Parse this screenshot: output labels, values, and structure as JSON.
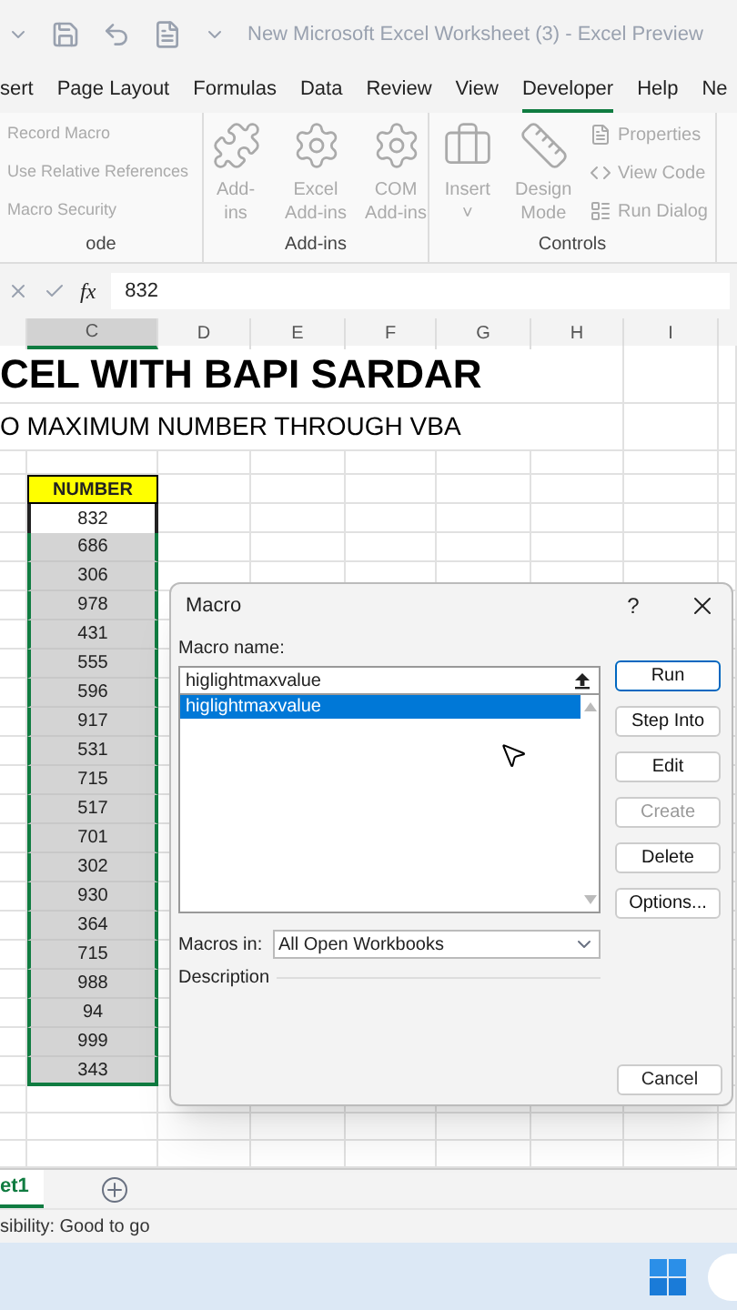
{
  "title_bar": {
    "title": "New Microsoft Excel Worksheet (3)  -  Excel Preview"
  },
  "ribbon_tabs": [
    {
      "label": "sert",
      "selected": false
    },
    {
      "label": "Page Layout",
      "selected": false
    },
    {
      "label": "Formulas",
      "selected": false
    },
    {
      "label": "Data",
      "selected": false
    },
    {
      "label": "Review",
      "selected": false
    },
    {
      "label": "View",
      "selected": false
    },
    {
      "label": "Developer",
      "selected": true
    },
    {
      "label": "Help",
      "selected": false
    },
    {
      "label": "Ne",
      "selected": false
    }
  ],
  "ribbon_groups": [
    {
      "label": "ode",
      "items": [
        {
          "kind": "small",
          "label": "Record Macro"
        },
        {
          "kind": "small",
          "label": "Use Relative References"
        },
        {
          "kind": "small",
          "label": "Macro Security"
        }
      ]
    },
    {
      "label": "Add-ins",
      "items": [
        {
          "kind": "large",
          "label": "Add-\nins"
        },
        {
          "kind": "large",
          "label": "Excel\nAdd-ins"
        },
        {
          "kind": "large",
          "label": "COM\nAdd-ins"
        }
      ]
    },
    {
      "label": "Controls",
      "items": [
        {
          "kind": "large",
          "label": "Insert\n˅"
        },
        {
          "kind": "large",
          "label": "Design\nMode"
        },
        {
          "kind": "small",
          "label": "Properties"
        },
        {
          "kind": "small",
          "label": "View Code"
        },
        {
          "kind": "small",
          "label": "Run Dialog"
        }
      ]
    }
  ],
  "formula_bar": {
    "fx_label": "fx",
    "value": "832"
  },
  "columns": [
    {
      "label": "C",
      "selected": true
    },
    {
      "label": "D",
      "selected": false
    },
    {
      "label": "E",
      "selected": false
    },
    {
      "label": "F",
      "selected": false
    },
    {
      "label": "G",
      "selected": false
    },
    {
      "label": "H",
      "selected": false
    },
    {
      "label": "I",
      "selected": false
    }
  ],
  "sheet": {
    "title": "CEL WITH BAPI SARDAR",
    "subtitle": "O MAXIMUM NUMBER THROUGH VBA",
    "header": "NUMBER",
    "range_selected": true,
    "values": [
      "832",
      "686",
      "306",
      "978",
      "431",
      "555",
      "596",
      "917",
      "531",
      "715",
      "517",
      "701",
      "302",
      "930",
      "364",
      "715",
      "988",
      "94",
      "999",
      "343"
    ]
  },
  "dialog": {
    "title": "Macro",
    "help": "?",
    "macro_name_label": "Macro name:",
    "macro_name_value": "higlightmaxvalue",
    "macros": [
      {
        "name": "higlightmaxvalue",
        "selected": true
      }
    ],
    "buttons": [
      {
        "label": "Run",
        "default": true,
        "disabled": false
      },
      {
        "label": "Step Into",
        "default": false,
        "disabled": false
      },
      {
        "label": "Edit",
        "default": false,
        "disabled": false
      },
      {
        "label": "Create",
        "default": false,
        "disabled": true
      },
      {
        "label": "Delete",
        "default": false,
        "disabled": false
      },
      {
        "label": "Options...",
        "default": false,
        "disabled": false
      }
    ],
    "macros_in_label": "Macros in:",
    "macros_in_value": "All Open Workbooks",
    "description_label": "Description",
    "cancel": "Cancel"
  },
  "sheet_tabs": [
    {
      "label": "et1",
      "selected": true
    }
  ],
  "status_bar": {
    "text": "sibility: Good to go"
  }
}
